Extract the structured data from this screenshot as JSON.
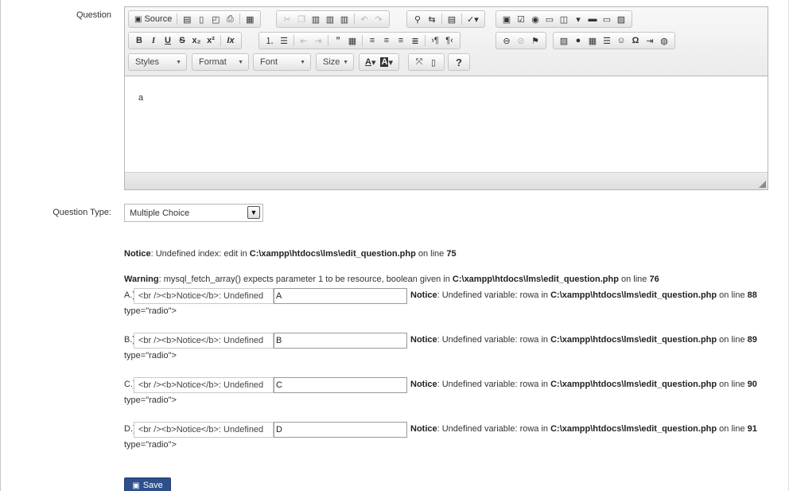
{
  "form": {
    "question_label": "Question",
    "question_type_label": "Question Type:",
    "question_type_value": "Multiple Choice",
    "save_label": "Save"
  },
  "editor": {
    "source_label": "Source",
    "styles_label": "Styles",
    "format_label": "Format",
    "font_label": "Font",
    "size_label": "Size",
    "help_label": "?",
    "content": "a"
  },
  "notices": {
    "edit_prefix": "Notice",
    "edit_text": ": Undefined index: edit in ",
    "edit_path": "C:\\xampp\\htdocs\\lms\\edit_question.php",
    "edit_line_text": " on line ",
    "edit_line": "75",
    "warning_prefix": "Warning",
    "warning_text": ": mysql_fetch_array() expects parameter 1 to be resource, boolean given in ",
    "warning_path": "C:\\xampp\\htdocs\\lms\\edit_question.php",
    "warning_line_text": " on line ",
    "warning_line": "76"
  },
  "options": [
    {
      "letter": "A.)",
      "radio_value": "<br /><b>Notice</b>:  Undefined",
      "text_value": "A",
      "notice_prefix": "Notice",
      "notice_text": ": Undefined variable: rowa in ",
      "notice_path": "C:\\xampp\\htdocs\\lms\\edit_question.php",
      "notice_line_text": " on line ",
      "notice_line": "88",
      "type_text": "type=\"radio\">"
    },
    {
      "letter": "B.)",
      "radio_value": "<br /><b>Notice</b>:  Undefined",
      "text_value": "B",
      "notice_prefix": "Notice",
      "notice_text": ": Undefined variable: rowa in ",
      "notice_path": "C:\\xampp\\htdocs\\lms\\edit_question.php",
      "notice_line_text": " on line ",
      "notice_line": "89",
      "type_text": "type=\"radio\">"
    },
    {
      "letter": "C.)",
      "radio_value": "<br /><b>Notice</b>:  Undefined",
      "text_value": "C",
      "notice_prefix": "Notice",
      "notice_text": ": Undefined variable: rowa in ",
      "notice_path": "C:\\xampp\\htdocs\\lms\\edit_question.php",
      "notice_line_text": " on line ",
      "notice_line": "90",
      "type_text": "type=\"radio\">"
    },
    {
      "letter": "D.)",
      "radio_value": "<br /><b>Notice</b>:  Undefined",
      "text_value": "D",
      "notice_prefix": "Notice",
      "notice_text": ": Undefined variable: rowa in ",
      "notice_path": "C:\\xampp\\htdocs\\lms\\edit_question.php",
      "notice_line_text": " on line ",
      "notice_line": "91",
      "type_text": "type=\"radio\">"
    }
  ]
}
